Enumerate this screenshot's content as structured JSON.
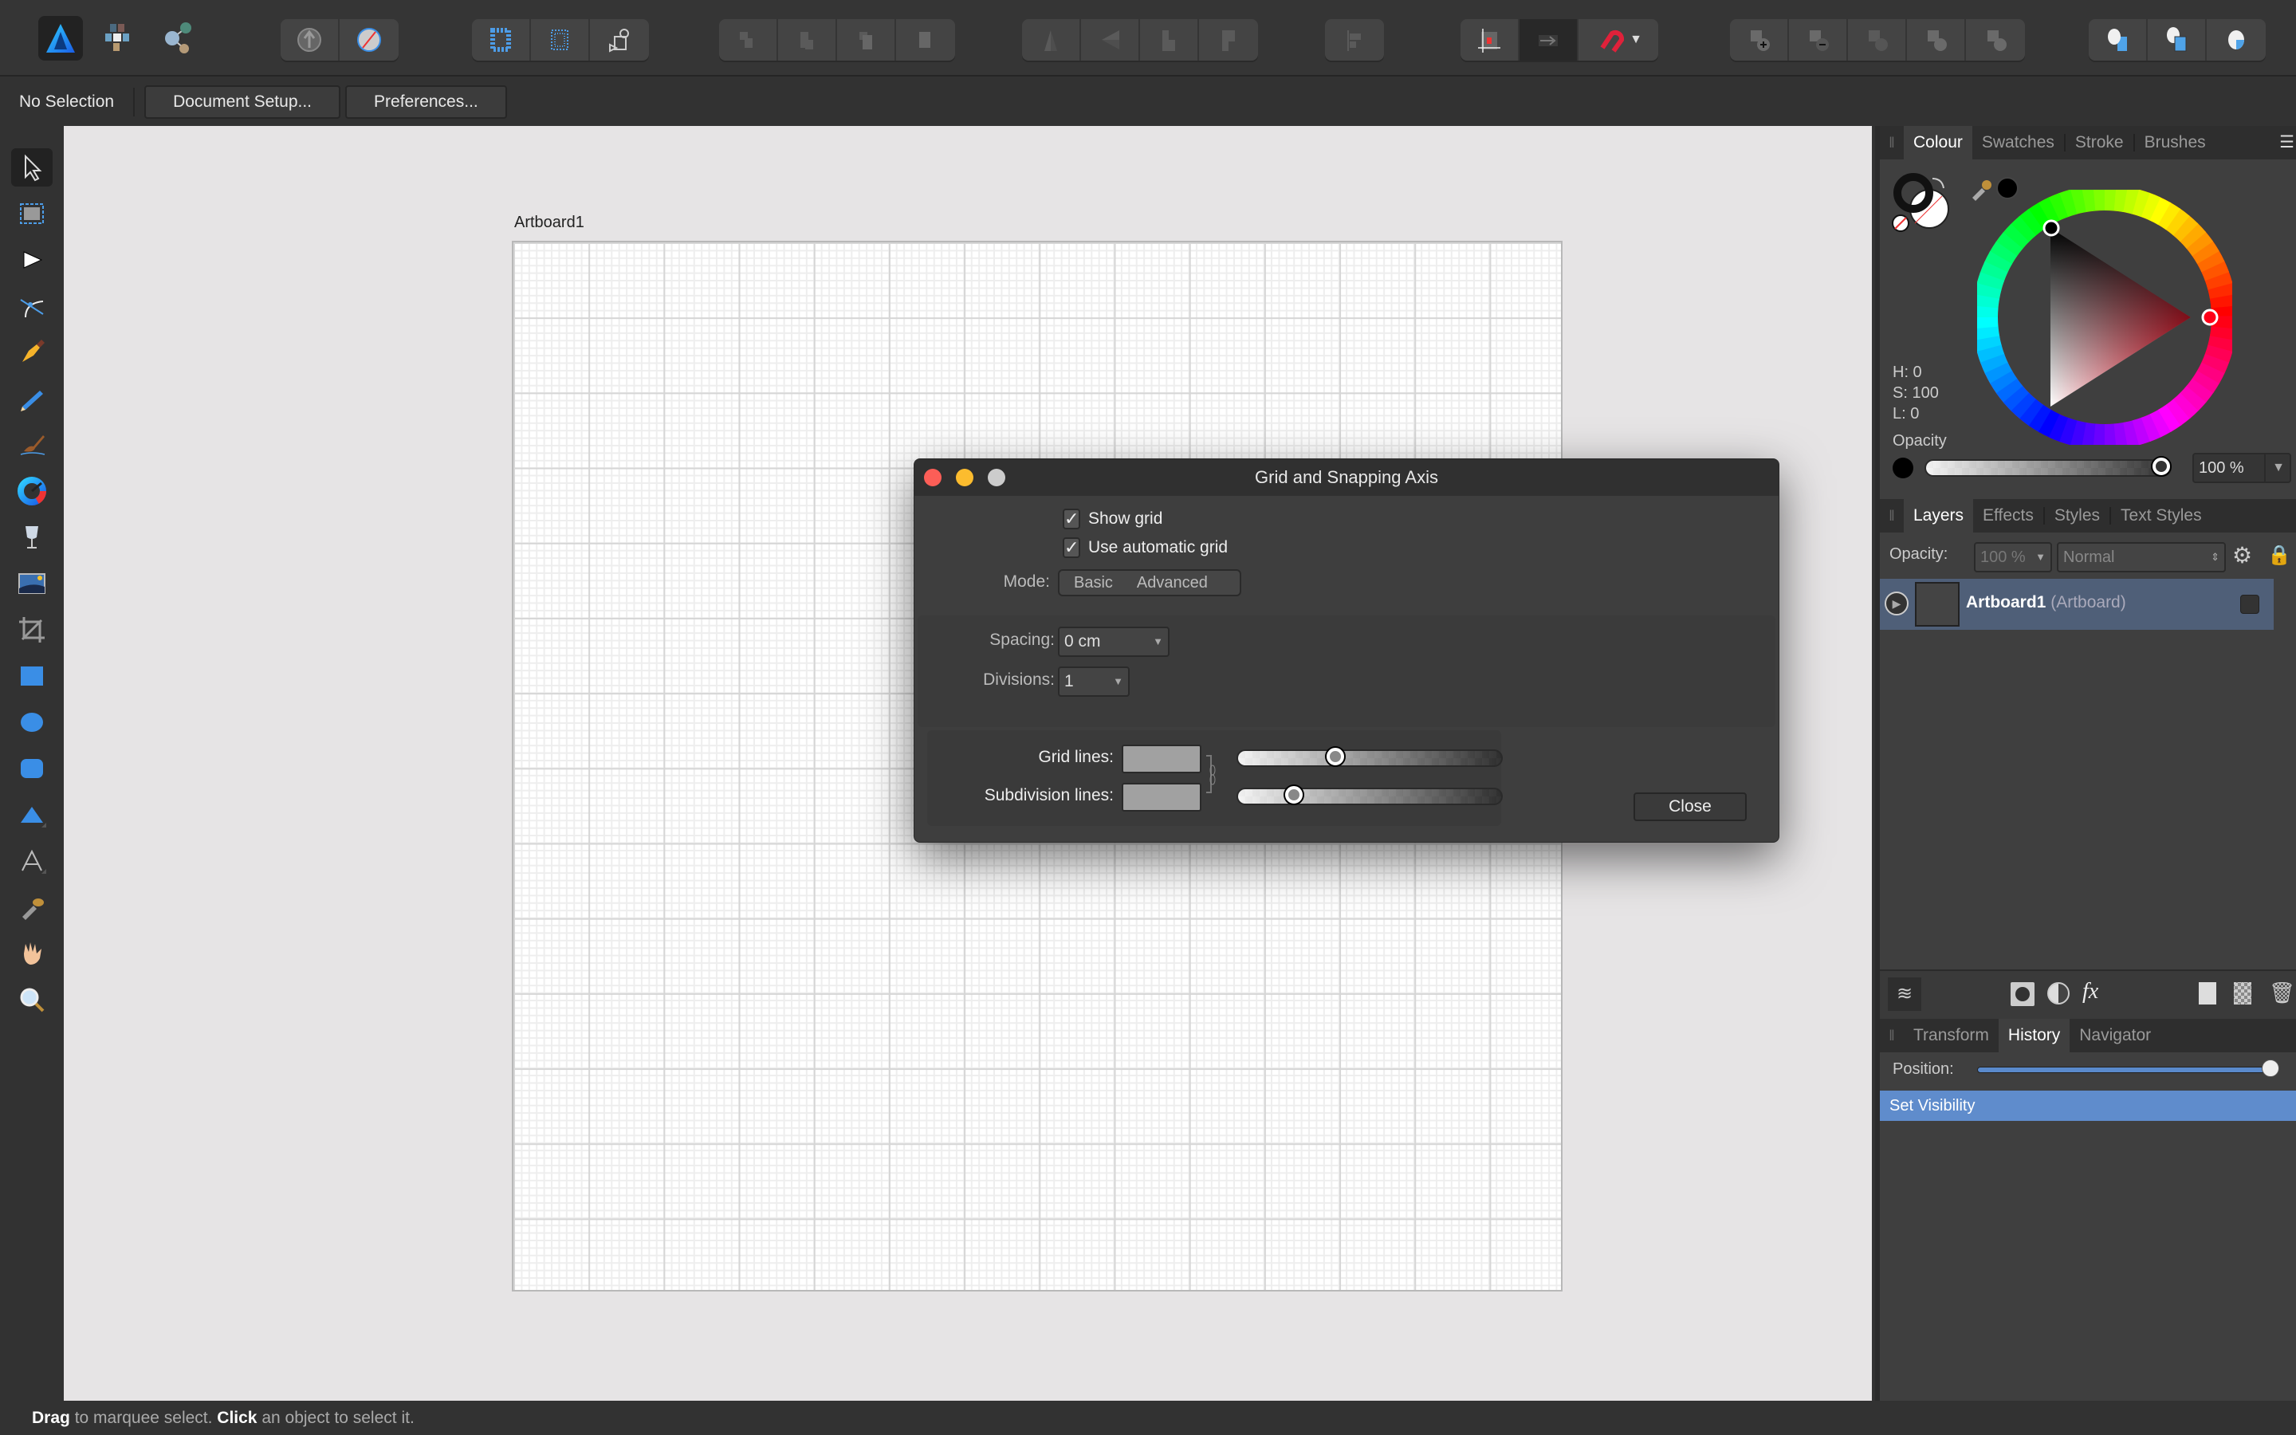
{
  "toolbar": {
    "personas": [
      "designer-persona",
      "pixel-persona",
      "export-persona"
    ],
    "groups": [
      {
        "name": "isolation",
        "buttons": [
          "isolate-icon",
          "hide-selection-icon"
        ]
      },
      {
        "name": "grids",
        "buttons": [
          "grid-snap-icon",
          "grid-icon",
          "transform-object-icon"
        ]
      },
      {
        "name": "arrange",
        "buttons": [
          "move-to-back-icon",
          "move-back-one-icon",
          "move-forward-one-icon",
          "move-to-front-icon"
        ]
      },
      {
        "name": "flip",
        "buttons": [
          "flip-horizontal-icon",
          "flip-vertical-icon",
          "rotate-left-icon",
          "rotate-right-icon"
        ]
      },
      {
        "name": "align",
        "buttons": [
          "align-icon"
        ]
      },
      {
        "name": "snapping",
        "buttons": [
          "snap-grid-icon",
          "snap-move-icon",
          "magnet-icon"
        ]
      },
      {
        "name": "boolean",
        "buttons": [
          "add-icon",
          "subtract-icon",
          "intersect-icon",
          "divide-icon",
          "combine-icon"
        ]
      },
      {
        "name": "insert",
        "buttons": [
          "insert-behind-icon",
          "insert-top-icon",
          "insert-inside-icon"
        ]
      }
    ]
  },
  "context": {
    "selection": "No Selection",
    "document_setup": "Document Setup...",
    "preferences": "Preferences..."
  },
  "tools": [
    "move-tool",
    "artboard-tool",
    "node-tool",
    "corner-tool",
    "pen-tool",
    "pencil-tool",
    "vector-brush-tool",
    "fill-tool",
    "transparency-tool",
    "place-image-tool",
    "crop-tool",
    "rectangle-tool",
    "ellipse-tool",
    "rounded-rectangle-tool",
    "triangle-tool",
    "text-tool",
    "color-picker-tool",
    "hand-tool",
    "zoom-tool"
  ],
  "canvas": {
    "artboard_name": "Artboard1"
  },
  "status": {
    "b1": "Drag",
    "t1": " to marquee select. ",
    "b2": "Click",
    "t2": " an object to select it."
  },
  "dialog": {
    "title": "Grid and Snapping Axis",
    "show_grid": "Show grid",
    "show_grid_checked": true,
    "auto_grid": "Use automatic grid",
    "auto_grid_checked": true,
    "mode_label": "Mode:",
    "mode_options": [
      "Basic",
      "Advanced"
    ],
    "spacing_label": "Spacing:",
    "spacing_value": "0 cm",
    "divisions_label": "Divisions:",
    "divisions_value": "1",
    "grid_lines_label": "Grid lines:",
    "subdivision_lines_label": "Subdivision lines:",
    "grid_lines_color": "#a1a1a1",
    "subdivision_lines_color": "#a1a1a1",
    "grid_lines_opacity": 0.36,
    "subdivision_lines_opacity": 0.19,
    "close": "Close"
  },
  "colour_panel": {
    "tabs": [
      "Colour",
      "Swatches",
      "Stroke",
      "Brushes"
    ],
    "active_tab": "Colour",
    "h": "H: 0",
    "s": "S: 100",
    "l": "L: 0",
    "opacity_label": "Opacity",
    "opacity_value": "100 %",
    "opacity_fraction": 1.0
  },
  "layers_panel": {
    "tabs": [
      "Layers",
      "Effects",
      "Styles",
      "Text Styles"
    ],
    "active_tab": "Layers",
    "opacity_label": "Opacity:",
    "opacity_value": "100 %",
    "blend_mode": "Normal",
    "layers": [
      {
        "name": "Artboard1",
        "type": "(Artboard)"
      }
    ]
  },
  "history_panel": {
    "tabs": [
      "Transform",
      "History",
      "Navigator"
    ],
    "active_tab": "History",
    "position_label": "Position:",
    "position_fraction": 1.0,
    "items": [
      "Set Visibility"
    ]
  }
}
